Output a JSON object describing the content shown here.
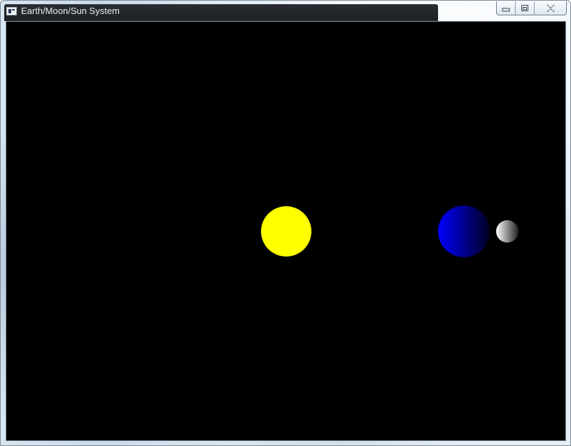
{
  "window": {
    "title": "Earth/Moon/Sun System",
    "icon": "app-window-icon"
  },
  "controls": {
    "minimize": "minimize-icon",
    "maximize": "maximize-icon",
    "close": "close-icon"
  },
  "scene": {
    "background": "#000000",
    "sun": {
      "color": "#ffff00"
    },
    "earth": {
      "light_color": "#0000ff",
      "dark_color": "#000020"
    },
    "moon": {
      "light_color": "#ffffff",
      "dark_color": "#202020"
    }
  }
}
